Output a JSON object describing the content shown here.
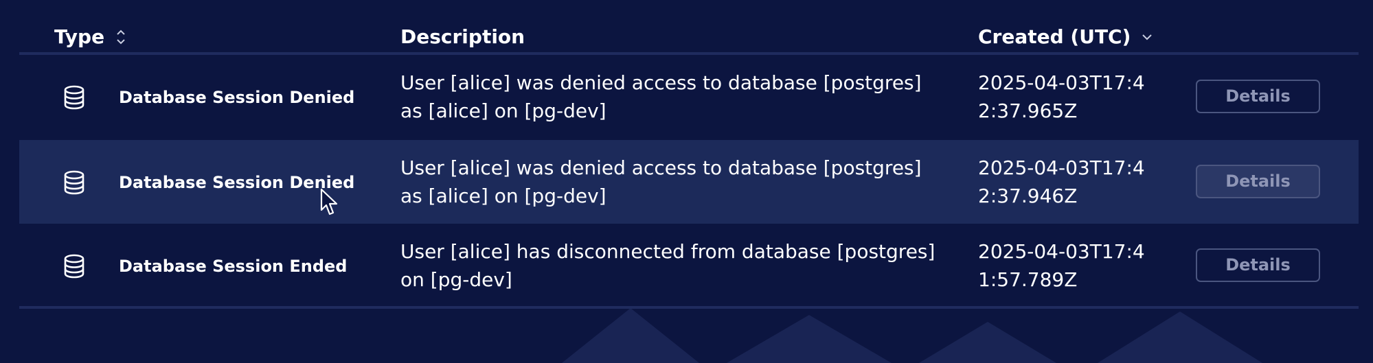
{
  "header": {
    "type_label": "Type",
    "description_label": "Description",
    "created_label": "Created (UTC)"
  },
  "rows": [
    {
      "icon": "database-icon",
      "type": "Database Session Denied",
      "description": "User [alice] was denied access to database [postgres] as [alice] on [pg-dev]",
      "created": "2025-04-03T17:42:37.965Z",
      "details_label": "Details"
    },
    {
      "icon": "database-icon",
      "type": "Database Session Denied",
      "description": "User [alice] was denied access to database [postgres] as [alice] on [pg-dev]",
      "created": "2025-04-03T17:42:37.946Z",
      "details_label": "Details"
    },
    {
      "icon": "database-icon",
      "type": "Database Session Ended",
      "description": "User [alice] has disconnected from database [postgres] on [pg-dev]",
      "created": "2025-04-03T17:41:57.789Z",
      "details_label": "Details"
    }
  ],
  "colors": {
    "background": "#0c1540",
    "row_hover": "#1c2a5a",
    "divider": "#1f2b5e",
    "button_border": "#4b5680",
    "button_text": "#8f96b6"
  }
}
